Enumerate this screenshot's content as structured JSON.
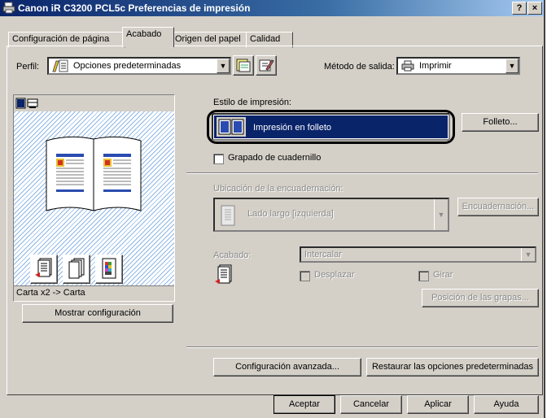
{
  "window": {
    "title": "Canon iR C3200 PCL5c Preferencias de impresión",
    "help_btn": "?",
    "close_btn": "×"
  },
  "tabs": [
    {
      "label": "Configuración de página"
    },
    {
      "label": "Acabado"
    },
    {
      "label": "Origen del papel"
    },
    {
      "label": "Calidad"
    }
  ],
  "profile": {
    "label": "Perfil:",
    "value": "Opciones predeterminadas"
  },
  "output": {
    "label": "Método de salida:",
    "value": "Imprimir"
  },
  "preview": {
    "caption": "Carta x2 -> Carta",
    "show_button": "Mostrar configuración"
  },
  "style": {
    "label": "Estilo de impresión:",
    "value": "Impresión en folleto",
    "folleto_button": "Folleto..."
  },
  "staple_booklet": {
    "label": "Grapado de cuadernillo",
    "checked": false
  },
  "binding": {
    "label": "Ubicación de la encuadernación:",
    "value": "Lado largo [izquierda]",
    "button": "Encuadernación..."
  },
  "finishing": {
    "label": "Acabado:",
    "value": "Intercalar",
    "offset_label": "Desplazar",
    "rotate_label": "Girar",
    "staple_pos_button": "Posición de las grapas..."
  },
  "advanced_button": "Configuración avanzada...",
  "restore_button": "Restaurar las opciones predeterminadas",
  "footer": {
    "ok": "Aceptar",
    "cancel": "Cancelar",
    "apply": "Aplicar",
    "help": "Ayuda"
  },
  "colors": {
    "title_start": "#0a246a",
    "title_end": "#a6caf0",
    "selected_bg": "#0a246a",
    "face": "#d4d0c8"
  }
}
